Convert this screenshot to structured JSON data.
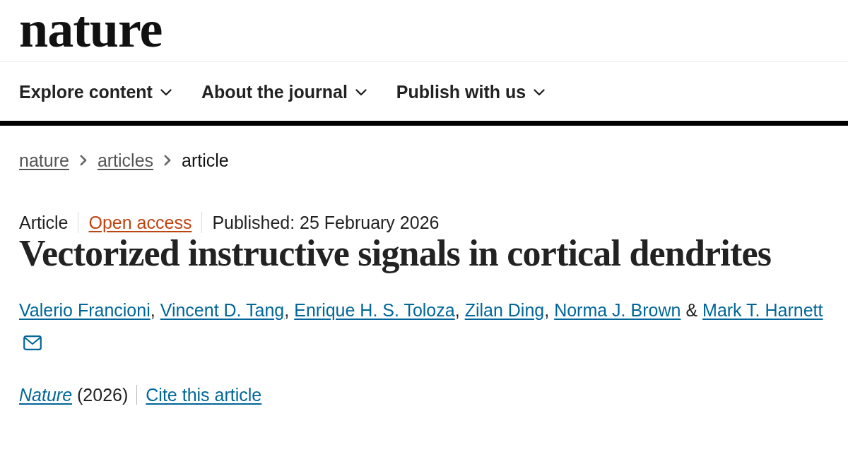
{
  "logo": {
    "text": "nature"
  },
  "nav": [
    {
      "label": "Explore content"
    },
    {
      "label": "About the journal"
    },
    {
      "label": "Publish with us"
    }
  ],
  "breadcrumb": [
    {
      "label": "nature",
      "kind": "link"
    },
    {
      "label": "articles",
      "kind": "link"
    },
    {
      "label": "article",
      "kind": "current"
    }
  ],
  "article": {
    "meta": [
      {
        "text": "Article",
        "kind": "type"
      },
      {
        "text": "Open access",
        "kind": "access"
      },
      {
        "text": "Published: 25 February 2026",
        "kind": "date"
      }
    ],
    "title": "Vectorized instructive signals in cortical dendrites",
    "authors": [
      {
        "name": "Valerio Francioni",
        "separator": ","
      },
      {
        "name": "Vincent D. Tang",
        "separator": ","
      },
      {
        "name": "Enrique H. S. Toloza",
        "separator": ","
      },
      {
        "name": "Zilan Ding",
        "separator": ","
      },
      {
        "name": "Norma J. Brown",
        "separator": "&"
      },
      {
        "name": "Mark T. Harnett"
      }
    ],
    "journal": "Nature",
    "year": "(2026)",
    "cite": "Cite this article"
  }
}
